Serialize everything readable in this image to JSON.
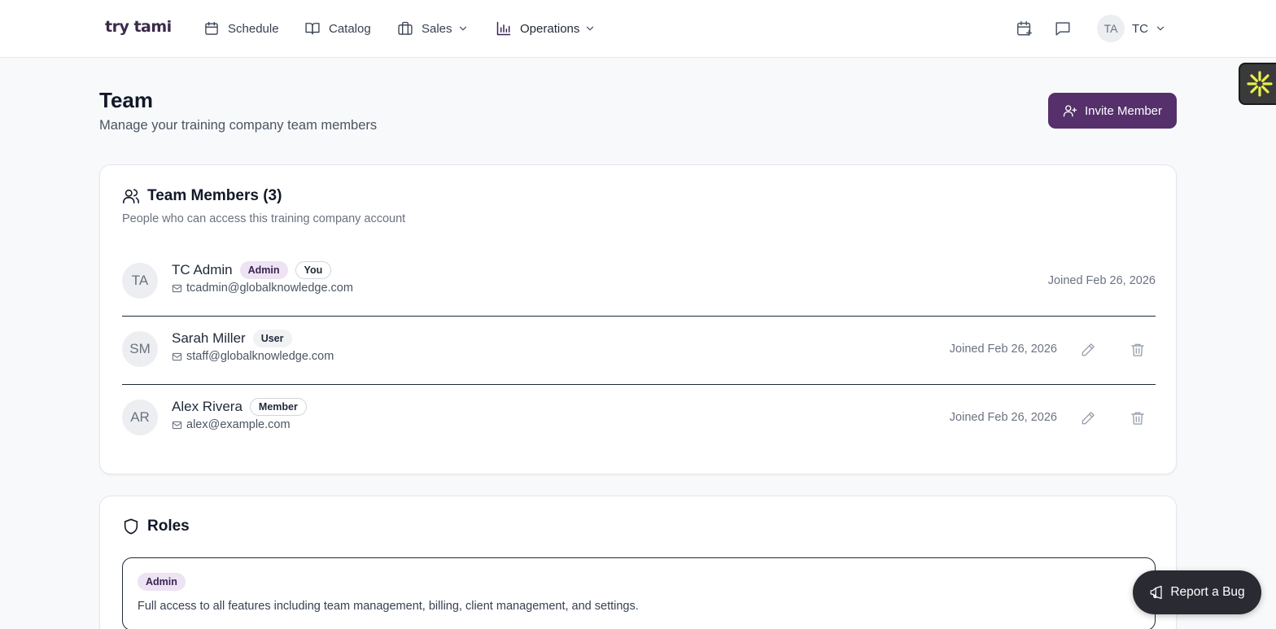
{
  "brand": {
    "logo_text": "try tami"
  },
  "nav": {
    "items": [
      {
        "label": "Schedule",
        "icon": "calendar-icon"
      },
      {
        "label": "Catalog",
        "icon": "book-icon"
      },
      {
        "label": "Sales",
        "icon": "briefcase-icon",
        "dropdown": true
      },
      {
        "label": "Operations",
        "icon": "bar-chart-icon",
        "dropdown": true
      }
    ],
    "user_initials": "TA",
    "user_menu_label": "TC"
  },
  "page": {
    "title": "Team",
    "subtitle": "Manage your training company team members",
    "invite_button": "Invite Member"
  },
  "members_card": {
    "title": "Team Members (3)",
    "description": "People who can access this training company account",
    "members": [
      {
        "initials": "TA",
        "name": "TC Admin",
        "badges": [
          "Admin",
          "You"
        ],
        "email": "tcadmin@globalknowledge.com",
        "joined": "Joined Feb 26, 2026",
        "actions": false
      },
      {
        "initials": "SM",
        "name": "Sarah Miller",
        "badges": [
          "User"
        ],
        "email": "staff@globalknowledge.com",
        "joined": "Joined Feb 26, 2026",
        "actions": true
      },
      {
        "initials": "AR",
        "name": "Alex Rivera",
        "badges": [
          "Member"
        ],
        "email": "alex@example.com",
        "joined": "Joined Feb 26, 2026",
        "actions": true
      }
    ]
  },
  "roles_card": {
    "title": "Roles",
    "roles": [
      {
        "badge": "Admin",
        "description": "Full access to all features including team management, billing, client management, and settings."
      }
    ]
  },
  "report_bug": {
    "label": "Report a Bug"
  },
  "colors": {
    "primary": "#55306b",
    "admin_badge_bg": "#ede3f3",
    "report_bg": "#2a2a33",
    "widget_accent": "#e8f04a"
  }
}
